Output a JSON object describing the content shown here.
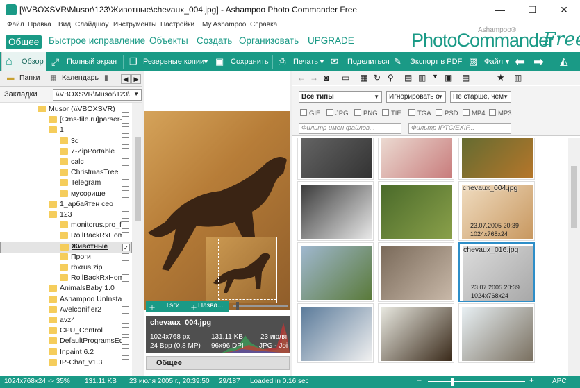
{
  "window": {
    "title": "[\\\\VBOXSVR\\Musor\\123\\Животные\\chevaux_004.jpg] - Ashampoo Photo Commander Free",
    "min": "—",
    "max": "☐",
    "close": "✕"
  },
  "menu": [
    "Файл",
    "Правка",
    "Вид",
    "Слайдшоу",
    "Инструменты",
    "Настройки",
    "My Ashampoo",
    "Справка"
  ],
  "categories": [
    "Общее",
    "Быстрое исправление",
    "Объекты",
    "Создать",
    "Организовать",
    "UPGRADE"
  ],
  "brand": {
    "photo": "PhotoCommander",
    "free": "Free",
    "ashampoo": "Ashampoo®"
  },
  "toolbar": {
    "overview": "Обзор",
    "fullscreen": "Полный экран",
    "backups": "Резервные копии",
    "save": "Сохранить",
    "print": "Печать",
    "share": "Поделиться",
    "pdf": "Экспорт в PDF",
    "file": "Файл"
  },
  "left": {
    "tab_folders": "Папки",
    "tab_calendar": "Календарь",
    "bookmarks": "Закладки",
    "path": "\\\\VBOXSVR\\Musor\\123\\"
  },
  "tree": [
    {
      "label": "Musor (\\\\VBOXSVR)",
      "level": 0
    },
    {
      "label": "[Cms-file.ru]parser-j",
      "level": 1
    },
    {
      "label": "1",
      "level": 1
    },
    {
      "label": "3d",
      "level": 2
    },
    {
      "label": "7-ZipPortable",
      "level": 2
    },
    {
      "label": "calc",
      "level": 2
    },
    {
      "label": "ChristmasTree",
      "level": 2
    },
    {
      "label": "Telegram",
      "level": 2
    },
    {
      "label": "мусорище",
      "level": 2
    },
    {
      "label": "1_арбайтен сео",
      "level": 1
    },
    {
      "label": "123",
      "level": 1
    },
    {
      "label": "monitorus.pro_f",
      "level": 2
    },
    {
      "label": "RollBackRxHom",
      "level": 2
    },
    {
      "label": "Животные",
      "level": 2,
      "selected": true
    },
    {
      "label": "Проги",
      "level": 2
    },
    {
      "label": "rbxrus.zip",
      "level": 2
    },
    {
      "label": "RollBackRxHom",
      "level": 2
    },
    {
      "label": "AnimalsBaby 1.0",
      "level": 1
    },
    {
      "label": "Ashampoo UnInstall",
      "level": 1
    },
    {
      "label": "Avelconifier2",
      "level": 1
    },
    {
      "label": "avz4",
      "level": 1
    },
    {
      "label": "CPU_Control",
      "level": 1
    },
    {
      "label": "DefaultProgramsEdi",
      "level": 1
    },
    {
      "label": "Inpaint 6.2",
      "level": 1
    },
    {
      "label": "IP-Chat_v1.3",
      "level": 1
    }
  ],
  "mid": {
    "tags": "Тэги",
    "names": "Назва...",
    "general": "Общее"
  },
  "info": {
    "filename": "chevaux_004.jpg",
    "dims": "1024x768 px",
    "size": "131.11 KB",
    "date": "23 июля",
    "bpp": "24 Bpp (0.8 MP)",
    "dpi": "96x96 DPI",
    "type": "JPG - Joi"
  },
  "filters": {
    "types": "Все типы",
    "ignore": "Игнорировать о",
    "age": "Не старше, чем",
    "checks": [
      "GIF",
      "JPG",
      "PNG",
      "TIF",
      "TGA",
      "PSD",
      "MP4",
      "MP3"
    ],
    "name_filter": "Фильтр имен файлов...",
    "iptc_filter": "Фильтр IPTC/EXIF..."
  },
  "thumbs": [
    {
      "name": "cats",
      "cap": ""
    },
    {
      "name": "kitten",
      "cap": ""
    },
    {
      "name": "deer",
      "cap": ""
    },
    {
      "name": "goat",
      "cap": ""
    },
    {
      "name": "frogs",
      "cap": ""
    },
    {
      "name": "horse-run",
      "cap": "chevaux_004.jpg",
      "meta1": "23.07.2005 20:39",
      "meta2": "1024x768x24"
    },
    {
      "name": "horses",
      "cap": ""
    },
    {
      "name": "horse-nose",
      "cap": ""
    },
    {
      "name": "horse-grey",
      "cap": "chevaux_016.jpg",
      "meta1": "23.07.2005 20:39",
      "meta2": "1024x768x24"
    },
    {
      "name": "polar-bear",
      "cap": ""
    },
    {
      "name": "eagle",
      "cap": ""
    },
    {
      "name": "elephant",
      "cap": ""
    }
  ],
  "status": {
    "res": "1024x768x24 -> 35%",
    "size": "131.11 KB",
    "date": "23 июля 2005 г., 20:39:50",
    "count": "29/187",
    "loaded": "Loaded in 0.16 sec",
    "lang": "APC"
  }
}
